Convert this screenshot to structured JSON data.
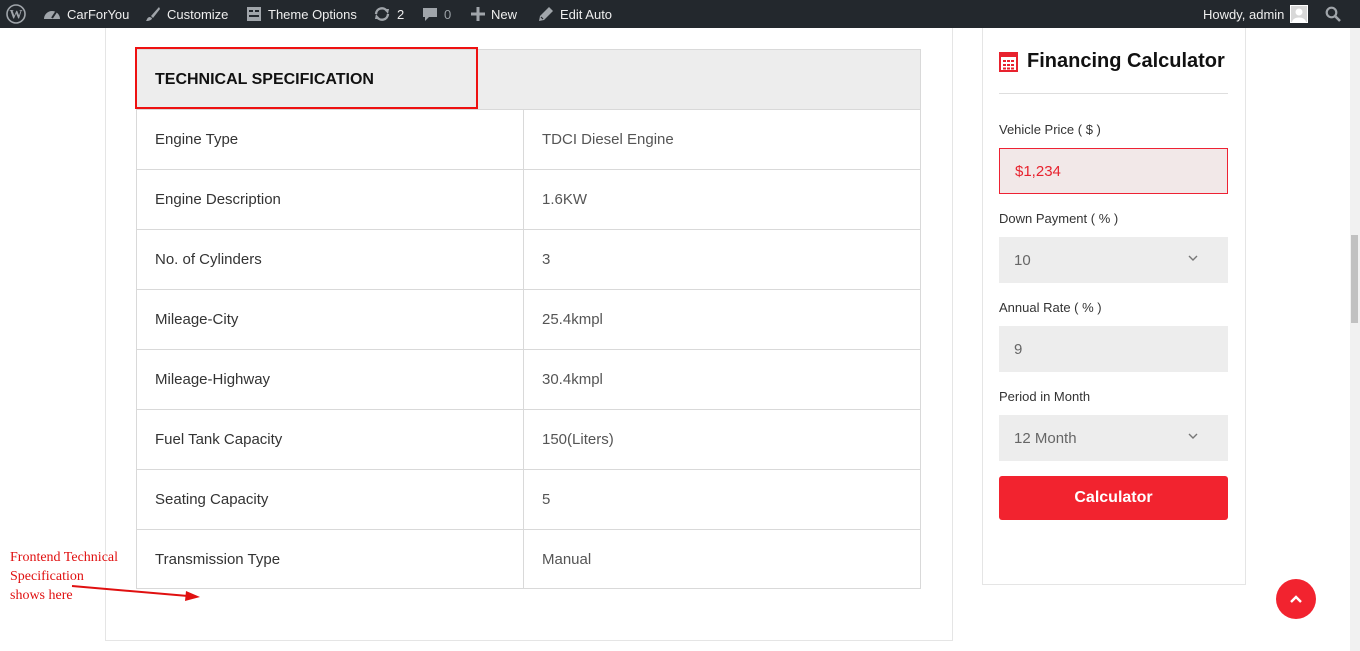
{
  "adminbar": {
    "site_name": "CarForYou",
    "customize": "Customize",
    "theme_options": "Theme Options",
    "updates_count": "2",
    "comments_count": "0",
    "new_label": "New",
    "edit_label": "Edit Auto",
    "greeting": "Howdy, admin"
  },
  "spec": {
    "title": "TECHNICAL SPECIFICATION",
    "rows": [
      {
        "label": "Engine Type",
        "value": "TDCI Diesel Engine"
      },
      {
        "label": "Engine Description",
        "value": "1.6KW"
      },
      {
        "label": "No. of Cylinders",
        "value": "3"
      },
      {
        "label": "Mileage-City",
        "value": "25.4kmpl"
      },
      {
        "label": "Mileage-Highway",
        "value": "30.4kmpl"
      },
      {
        "label": "Fuel Tank Capacity",
        "value": "150(Liters)"
      },
      {
        "label": "Seating Capacity",
        "value": "5"
      },
      {
        "label": "Transmission Type",
        "value": "Manual"
      }
    ]
  },
  "annotation": {
    "lines": [
      "Frontend Technical",
      "Specification",
      "shows here"
    ]
  },
  "calculator": {
    "title": "Financing Calculator",
    "price_label": "Vehicle Price ( $ )",
    "price_value": "$1,234",
    "down_label": "Down Payment ( % )",
    "down_value": "10",
    "rate_label": "Annual Rate ( % )",
    "rate_value": "9",
    "period_label": "Period in Month",
    "period_value": "12 Month",
    "button_label": "Calculator"
  },
  "colors": {
    "accent": "#f2232f",
    "adminbar_bg": "#23282d",
    "annotation": "#e01010"
  }
}
